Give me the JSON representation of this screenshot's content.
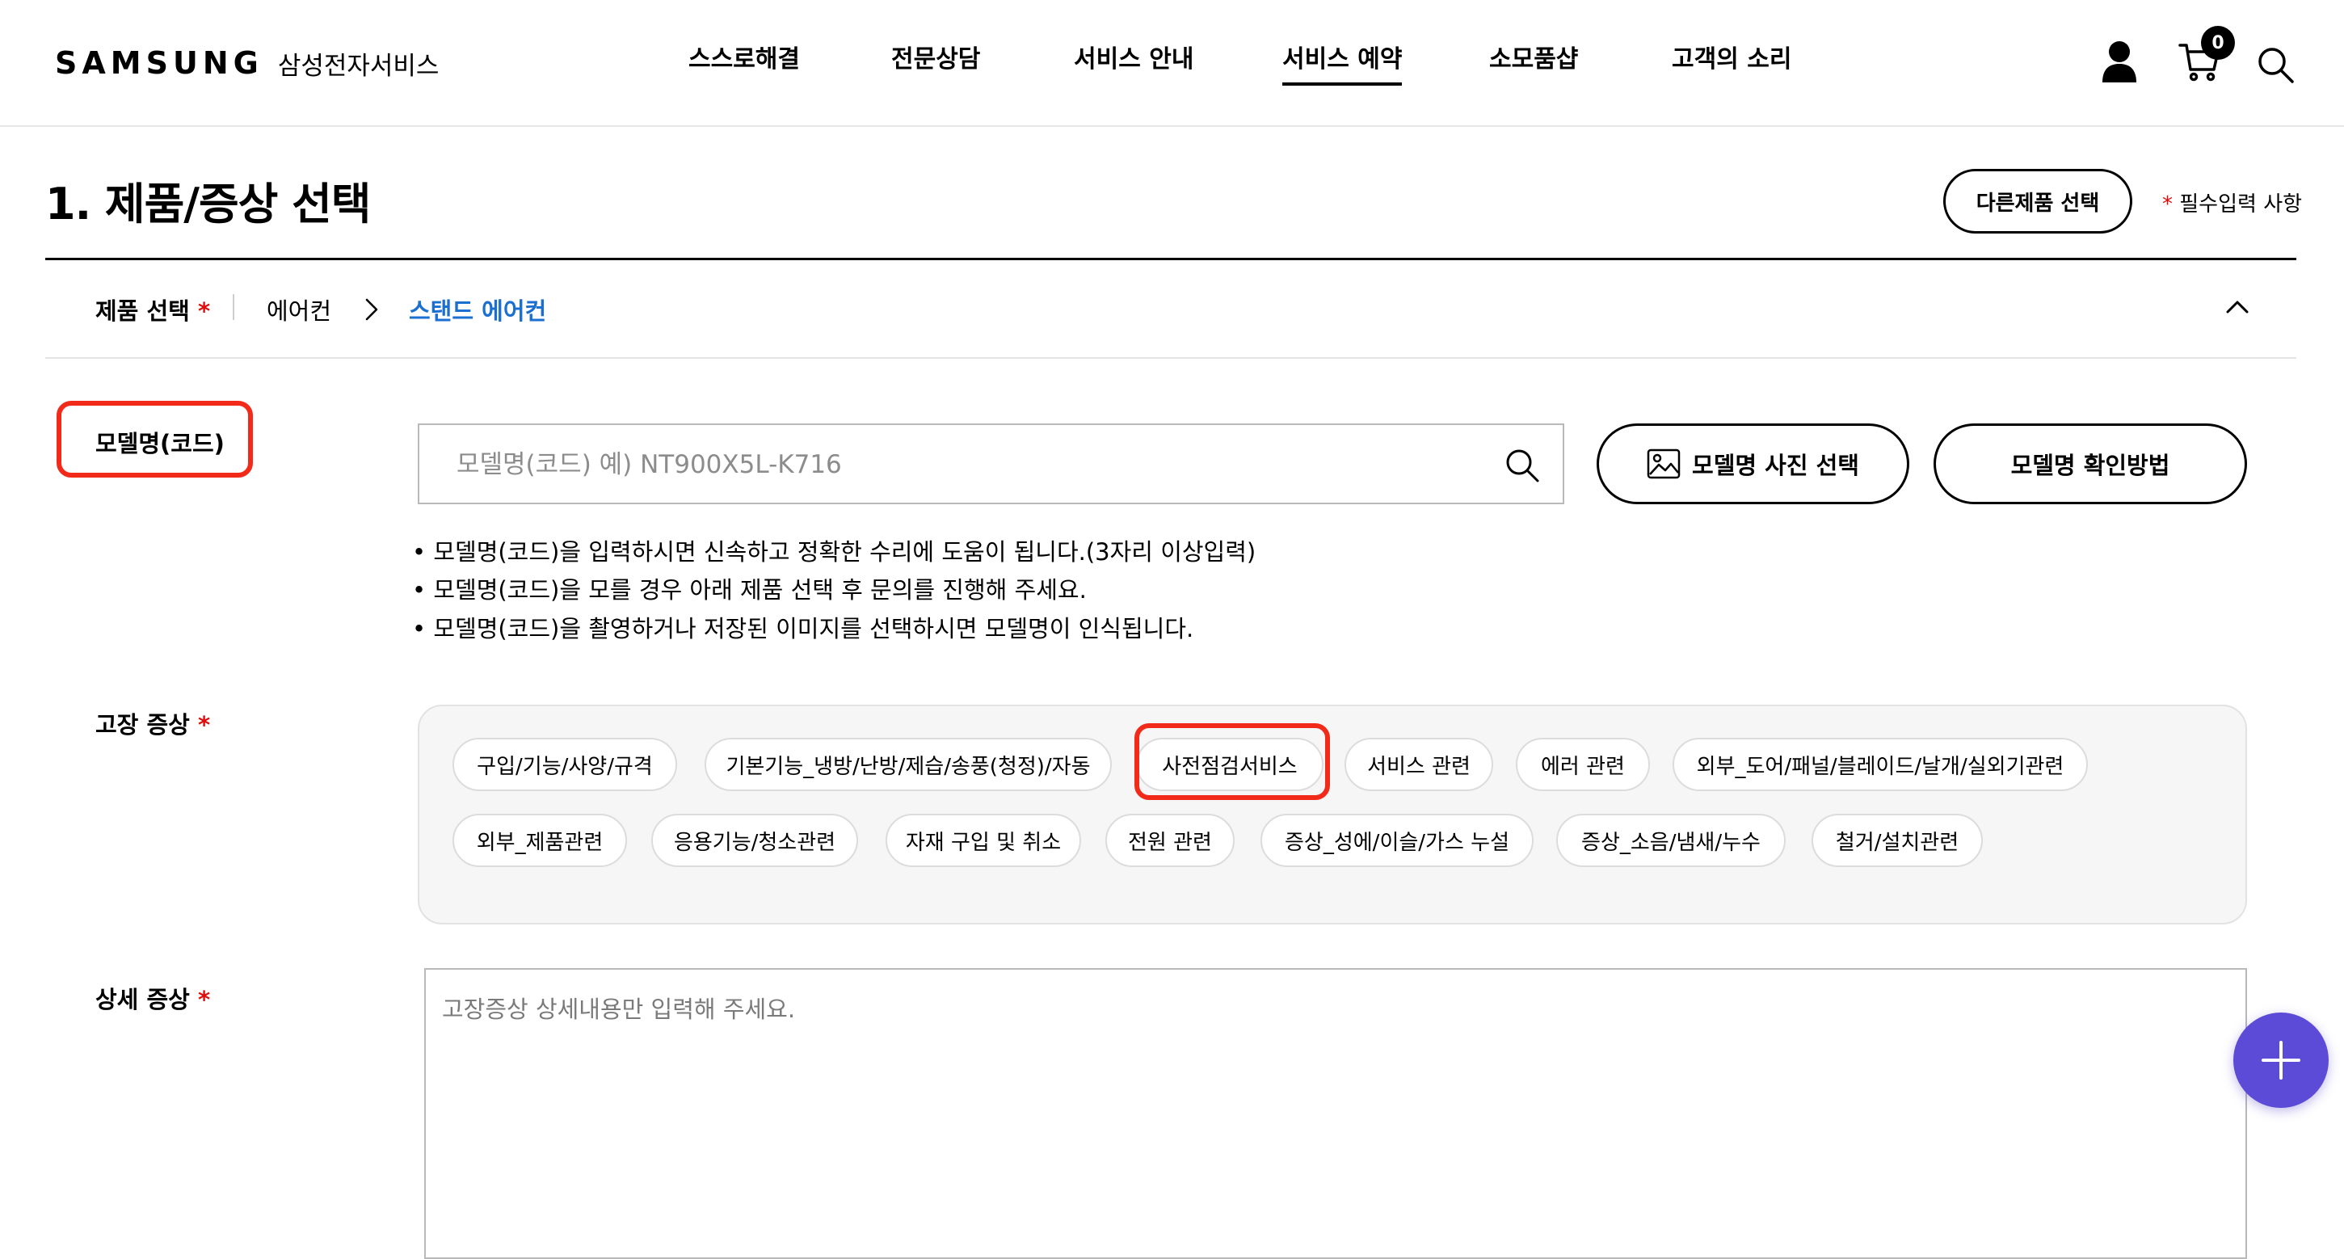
{
  "header": {
    "logo": "SAMSUNG",
    "logo_sub": "삼성전자서비스",
    "nav": [
      "스스로해결",
      "전문상담",
      "서비스 안내",
      "서비스 예약",
      "소모품샵",
      "고객의 소리"
    ],
    "active_nav": "서비스 예약",
    "cart_count": "0",
    "icons": [
      "user-icon",
      "cart-icon",
      "search-icon"
    ]
  },
  "page": {
    "title": "1. 제품/증상 선택",
    "other_product_button": "다른제품 선택",
    "required_mark": "*",
    "required_note": "필수입력 사항"
  },
  "product": {
    "label": "제품 선택",
    "category": "에어컨",
    "selected": "스탠드 에어컨",
    "selected_color": "#1a6fd1"
  },
  "model": {
    "label": "모델명(코드)",
    "placeholder": "모델명(코드) 예) NT900X5L-K716",
    "value": "",
    "photo_button": "모델명 사진 선택",
    "help_button": "모델명 확인방법",
    "hints": [
      "모델명(코드)을 입력하시면 신속하고 정확한 수리에 도움이 됩니다.(3자리 이상입력)",
      "모델명(코드)을 모를 경우 아래 제품 선택 후 문의를 진행해 주세요.",
      "모델명(코드)을 촬영하거나 저장된 이미지를 선택하시면 모델명이 인식됩니다."
    ]
  },
  "symptom": {
    "label": "고장 증상",
    "chips_row1": [
      "구입/기능/사양/규격",
      "기본기능_냉방/난방/제습/송풍(청정)/자동",
      "사전점검서비스",
      "서비스 관련",
      "에러 관련",
      "외부_도어/패널/블레이드/날개/실외기관련"
    ],
    "chips_row2": [
      "외부_제품관련",
      "응용기능/청소관련",
      "자재 구입 및 취소",
      "전원 관련",
      "증상_성에/이슬/가스 누설",
      "증상_소음/냄새/누수",
      "철거/설치관련"
    ],
    "highlighted": "사전점검서비스"
  },
  "detail": {
    "label": "상세 증상",
    "placeholder": "고장증상 상세내용만 입력해 주세요.",
    "value": ""
  },
  "colors": {
    "highlight": "#f22a1a",
    "required": "#e10d0d",
    "fab": "#5b4bd6"
  }
}
